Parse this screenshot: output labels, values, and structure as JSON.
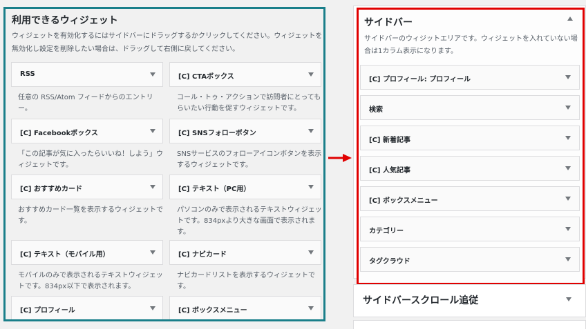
{
  "available": {
    "title": "利用できるウィジェット",
    "description": "ウィジェットを有効化するにはサイドバーにドラッグするかクリックしてください。ウィジェットを無効化し設定を削除したい場合は、ドラッグして右側に戻してください。",
    "widgets": [
      {
        "title": "RSS",
        "desc": "任意の RSS/Atom フィードからのエントリー。"
      },
      {
        "title": "[C] CTAボックス",
        "desc": "コール・トゥ・アクションで訪問者にとってもらいたい行動を促すウィジェットです。"
      },
      {
        "title": "[C] Facebookボックス",
        "desc": "「この記事が気に入ったらいいね！しよう」ウィジェットです。"
      },
      {
        "title": "[C] SNSフォローボタン",
        "desc": "SNSサービスのフォローアイコンボタンを表示するウィジェットです。"
      },
      {
        "title": "[C] おすすめカード",
        "desc": "おすすめカード一覧を表示するウィジェットです。"
      },
      {
        "title": "[C] テキスト（PC用）",
        "desc": "パソコンのみで表示されるテキストウィジェットです。834pxより大きな画面で表示されます。"
      },
      {
        "title": "[C] テキスト（モバイル用）",
        "desc": "モバイルのみで表示されるテキストウィジェットです。834px以下で表示されます。"
      },
      {
        "title": "[C] ナビカード",
        "desc": "ナビカードリストを表示するウィジェットです。"
      },
      {
        "title": "[C] プロフィール",
        "desc": ""
      },
      {
        "title": "[C] ボックスメニュー",
        "desc": ""
      }
    ]
  },
  "sidebar": {
    "title": "サイドバー",
    "description": "サイドバーのウィジットエリアです。ウィジェットを入れていない場合は1カラム表示になります。",
    "widgets": [
      {
        "title": "[C] プロフィール: プロフィール"
      },
      {
        "title": "検索"
      },
      {
        "title": "[C] 新着記事"
      },
      {
        "title": "[C] 人気記事"
      },
      {
        "title": "[C] ボックスメニュー"
      },
      {
        "title": "カテゴリー"
      },
      {
        "title": "タグクラウド"
      }
    ]
  },
  "scroll_follow": {
    "title": "サイドバースクロール追従"
  },
  "colors": {
    "available_border": "#1a7f8a",
    "sidebar_border": "#e00000",
    "arrow": "#e00000"
  }
}
